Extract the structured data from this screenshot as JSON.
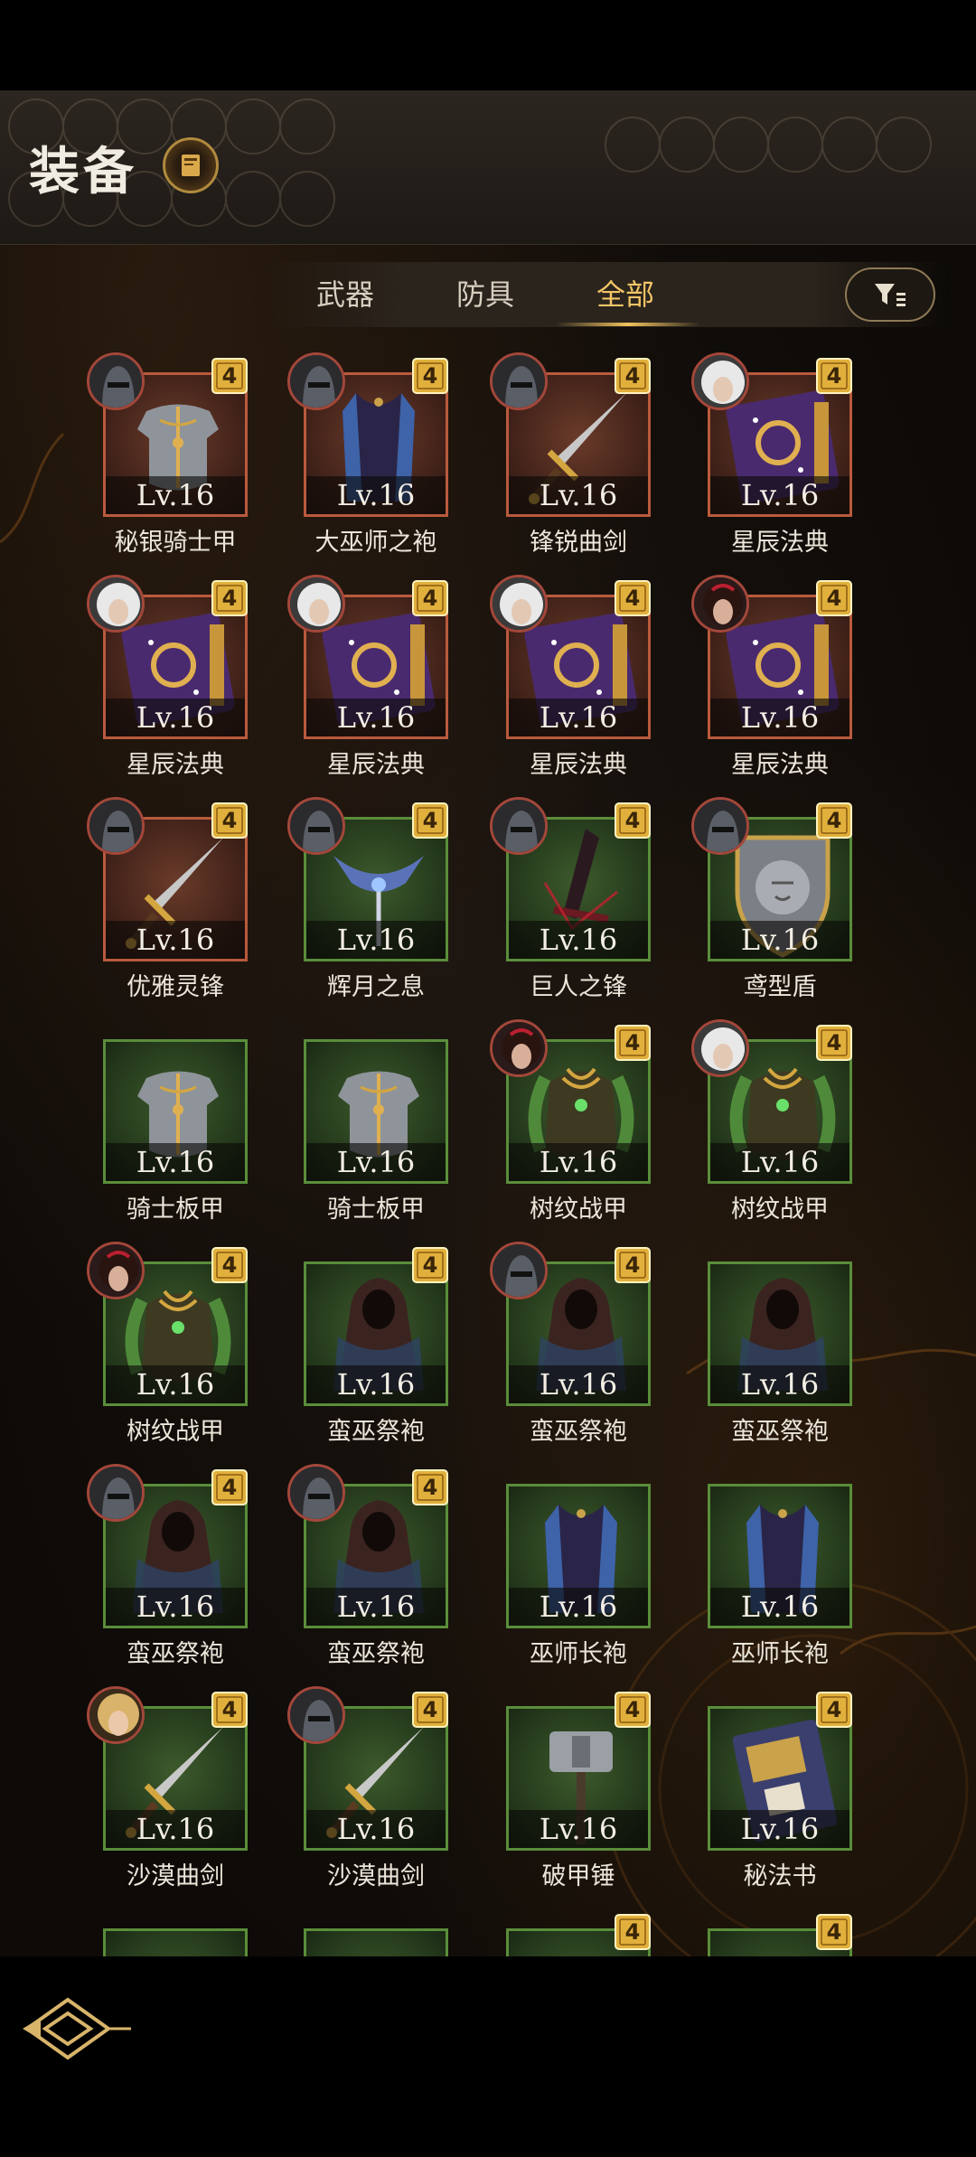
{
  "header": {
    "title": "装备"
  },
  "tabs": [
    {
      "label": "武器",
      "active": false
    },
    {
      "label": "防具",
      "active": false
    },
    {
      "label": "全部",
      "active": true
    }
  ],
  "items": [
    {
      "name": "秘银骑士甲",
      "level": "Lv.16",
      "quality": "red",
      "icon": "plate-armor-icon",
      "rank": "4",
      "equipped_by": "helmet-hero"
    },
    {
      "name": "大巫师之袍",
      "level": "Lv.16",
      "quality": "red",
      "icon": "robe-icon",
      "rank": "4",
      "equipped_by": "helmet-hero"
    },
    {
      "name": "锋锐曲剑",
      "level": "Lv.16",
      "quality": "red",
      "icon": "sword-icon",
      "rank": "4",
      "equipped_by": "helmet-hero"
    },
    {
      "name": "星辰法典",
      "level": "Lv.16",
      "quality": "red",
      "icon": "spellbook-icon",
      "rank": "4",
      "equipped_by": "white-hair-hero"
    },
    {
      "name": "星辰法典",
      "level": "Lv.16",
      "quality": "red",
      "icon": "spellbook-icon",
      "rank": "4",
      "equipped_by": "white-hair-hero"
    },
    {
      "name": "星辰法典",
      "level": "Lv.16",
      "quality": "red",
      "icon": "spellbook-icon",
      "rank": "4",
      "equipped_by": "white-hair-hero"
    },
    {
      "name": "星辰法典",
      "level": "Lv.16",
      "quality": "red",
      "icon": "spellbook-icon",
      "rank": "4",
      "equipped_by": "white-hair-hero"
    },
    {
      "name": "星辰法典",
      "level": "Lv.16",
      "quality": "red",
      "icon": "spellbook-icon",
      "rank": "4",
      "equipped_by": "dark-hair-hero"
    },
    {
      "name": "优雅灵锋",
      "level": "Lv.16",
      "quality": "red",
      "icon": "sword-icon",
      "rank": "4",
      "equipped_by": "helmet-hero"
    },
    {
      "name": "辉月之息",
      "level": "Lv.16",
      "quality": "green",
      "icon": "crossed-blades-icon",
      "rank": "4",
      "equipped_by": "helmet-hero"
    },
    {
      "name": "巨人之锋",
      "level": "Lv.16",
      "quality": "green",
      "icon": "dark-blade-icon",
      "rank": "4",
      "equipped_by": "helmet-hero"
    },
    {
      "name": "鸢型盾",
      "level": "Lv.16",
      "quality": "green",
      "icon": "lion-shield-icon",
      "rank": "4",
      "equipped_by": "helmet-hero"
    },
    {
      "name": "骑士板甲",
      "level": "Lv.16",
      "quality": "green",
      "icon": "plate-armor-icon",
      "rank": "",
      "equipped_by": ""
    },
    {
      "name": "骑士板甲",
      "level": "Lv.16",
      "quality": "green",
      "icon": "plate-armor-icon",
      "rank": "",
      "equipped_by": ""
    },
    {
      "name": "树纹战甲",
      "level": "Lv.16",
      "quality": "green",
      "icon": "leaf-armor-icon",
      "rank": "4",
      "equipped_by": "dark-hair-hero"
    },
    {
      "name": "树纹战甲",
      "level": "Lv.16",
      "quality": "green",
      "icon": "leaf-armor-icon",
      "rank": "4",
      "equipped_by": "white-hair-hero"
    },
    {
      "name": "树纹战甲",
      "level": "Lv.16",
      "quality": "green",
      "icon": "leaf-armor-icon",
      "rank": "4",
      "equipped_by": "dark-hair-hero"
    },
    {
      "name": "蛮巫祭袍",
      "level": "Lv.16",
      "quality": "green",
      "icon": "hooded-robe-icon",
      "rank": "4",
      "equipped_by": ""
    },
    {
      "name": "蛮巫祭袍",
      "level": "Lv.16",
      "quality": "green",
      "icon": "hooded-robe-icon",
      "rank": "4",
      "equipped_by": "helmet-hero"
    },
    {
      "name": "蛮巫祭袍",
      "level": "Lv.16",
      "quality": "green",
      "icon": "hooded-robe-icon",
      "rank": "",
      "equipped_by": ""
    },
    {
      "name": "蛮巫祭袍",
      "level": "Lv.16",
      "quality": "green",
      "icon": "hooded-robe-icon",
      "rank": "4",
      "equipped_by": "helmet-hero"
    },
    {
      "name": "蛮巫祭袍",
      "level": "Lv.16",
      "quality": "green",
      "icon": "hooded-robe-icon",
      "rank": "4",
      "equipped_by": "helmet-hero"
    },
    {
      "name": "巫师长袍",
      "level": "Lv.16",
      "quality": "green",
      "icon": "robe-icon",
      "rank": "",
      "equipped_by": ""
    },
    {
      "name": "巫师长袍",
      "level": "Lv.16",
      "quality": "green",
      "icon": "robe-icon",
      "rank": "",
      "equipped_by": ""
    },
    {
      "name": "沙漠曲剑",
      "level": "Lv.16",
      "quality": "green",
      "icon": "sword-icon",
      "rank": "4",
      "equipped_by": "blonde-hero"
    },
    {
      "name": "沙漠曲剑",
      "level": "Lv.16",
      "quality": "green",
      "icon": "sword-icon",
      "rank": "4",
      "equipped_by": "helmet-hero"
    },
    {
      "name": "破甲锤",
      "level": "Lv.16",
      "quality": "green",
      "icon": "hammer-icon",
      "rank": "4",
      "equipped_by": ""
    },
    {
      "name": "秘法书",
      "level": "Lv.16",
      "quality": "green",
      "icon": "tome-icon",
      "rank": "4",
      "equipped_by": ""
    },
    {
      "name": "",
      "level": "",
      "quality": "green",
      "icon": "",
      "rank": "",
      "equipped_by": ""
    },
    {
      "name": "",
      "level": "",
      "quality": "green",
      "icon": "",
      "rank": "",
      "equipped_by": ""
    },
    {
      "name": "",
      "level": "",
      "quality": "green",
      "icon": "",
      "rank": "4",
      "equipped_by": ""
    },
    {
      "name": "",
      "level": "",
      "quality": "green",
      "icon": "",
      "rank": "4",
      "equipped_by": ""
    }
  ],
  "colors": {
    "red_frame": "#b95a3d",
    "green_frame": "#5a8d3a",
    "rank_badge": "#e1b03c",
    "active_tab": "#f2c567"
  }
}
